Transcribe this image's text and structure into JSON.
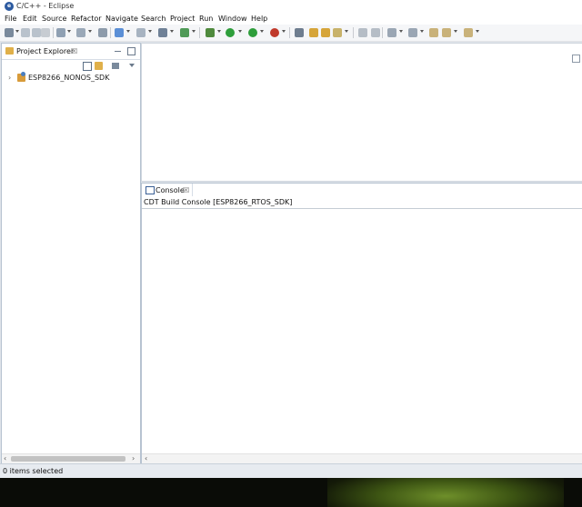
{
  "window": {
    "title": "C/C++ - Eclipse",
    "logo_letter": "e"
  },
  "menubar": {
    "items": [
      "File",
      "Edit",
      "Source",
      "Refactor",
      "Navigate",
      "Search",
      "Project",
      "Run",
      "Window",
      "Help"
    ]
  },
  "toolbar": {
    "icons": [
      "new-icon",
      "save-icon",
      "save-all-icon",
      "build-icon",
      "build-config-icon",
      "debug-config-icon",
      "search-icon",
      "new-cpp-icon",
      "new-class-icon",
      "open-element-icon",
      "refresh-icon",
      "target-icon",
      "run-icon",
      "debug-icon",
      "external-tools-icon",
      "open-type-icon",
      "open-folder-icon",
      "pen-icon",
      "task-icon",
      "annotation-icon",
      "next-annotation-icon",
      "prev-annotation-icon",
      "back-icon",
      "forward-icon"
    ]
  },
  "explorer": {
    "tab_title": "Project Explorer",
    "close_glyph": "☒",
    "tree": [
      {
        "label": "ESP8266_NONOS_SDK",
        "expander": "›"
      }
    ]
  },
  "console": {
    "tab_title": "Console",
    "close_glyph": "☒",
    "description": "CDT Build Console [ESP8266_RTOS_SDK]"
  },
  "scroll": {
    "left_arrow": "‹",
    "right_arrow": "›"
  },
  "statusbar": {
    "text": "0 items selected"
  },
  "colors": {
    "accent": "#2c5aa0",
    "panel_border": "#b7c3d1",
    "workspace_bg": "#dfe4ea"
  }
}
